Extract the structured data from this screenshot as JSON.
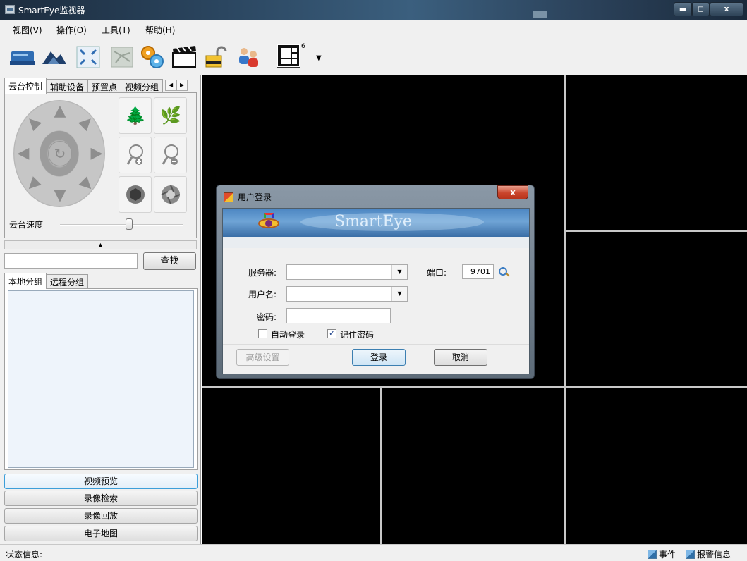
{
  "window": {
    "title": "SmartEye监视器",
    "controls": {
      "minimize": "▬",
      "maximize": "◻",
      "close": "x"
    }
  },
  "menubar": {
    "items": [
      "视图(V)",
      "操作(O)",
      "工具(T)",
      "帮助(H)"
    ]
  },
  "toolbar": {
    "buttons": [
      "preview-icon",
      "mountain-icon",
      "fullscreen-icon",
      "map-icon",
      "settings-gears-icon",
      "clapperboard-icon",
      "lock-icon",
      "users-icon"
    ],
    "layout_count": "6"
  },
  "left_panel": {
    "tabs": [
      "云台控制",
      "辅助设备",
      "预置点",
      "视频分组"
    ],
    "ptz": {
      "speed_label": "云台速度",
      "speed_value": 0.56
    },
    "search_button": "查找",
    "group_tabs": [
      "本地分组",
      "远程分组"
    ],
    "nav_buttons": [
      "视频预览",
      "录像检索",
      "录像回放",
      "电子地图"
    ]
  },
  "statusbar": {
    "label": "状态信息:",
    "events": "事件",
    "alarms": "报警信息"
  },
  "login_dialog": {
    "title": "用户登录",
    "close_label": "x",
    "banner_title": "SmartEye",
    "server_label": "服务器:",
    "server_value": "",
    "port_label": "端口:",
    "port_value": "9701",
    "username_label": "用户名:",
    "username_value": "",
    "password_label": "密码:",
    "password_value": "",
    "auto_login_label": "自动登录",
    "auto_login_checked": false,
    "remember_password_label": "记住密码",
    "remember_password_checked": true,
    "advanced_button": "高级设置",
    "login_button": "登录",
    "cancel_button": "取消"
  }
}
